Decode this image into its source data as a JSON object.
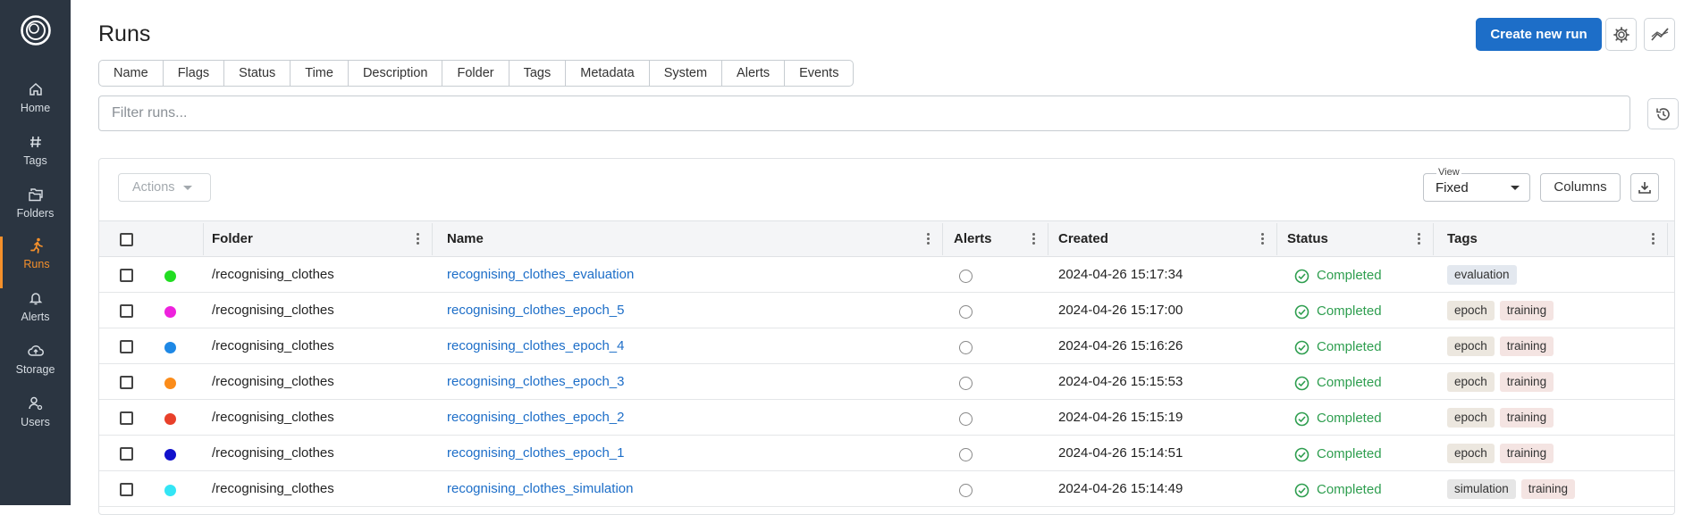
{
  "nav": [
    {
      "label": "Home",
      "icon": "home-icon"
    },
    {
      "label": "Tags",
      "icon": "hash-icon"
    },
    {
      "label": "Folders",
      "icon": "folders-icon"
    },
    {
      "label": "Runs",
      "icon": "running-icon",
      "active": true
    },
    {
      "label": "Alerts",
      "icon": "bell-icon"
    },
    {
      "label": "Storage",
      "icon": "cloud-upload-icon"
    },
    {
      "label": "Users",
      "icon": "users-icon"
    }
  ],
  "header": {
    "title": "Runs",
    "create_label": "Create new run"
  },
  "column_tabs": [
    "Name",
    "Flags",
    "Status",
    "Time",
    "Description",
    "Folder",
    "Tags",
    "Metadata",
    "System",
    "Alerts",
    "Events"
  ],
  "filter": {
    "placeholder": "Filter runs..."
  },
  "toolbar": {
    "actions_label": "Actions",
    "view_legend": "View",
    "view_value": "Fixed",
    "columns_label": "Columns"
  },
  "table": {
    "headers": {
      "folder": "Folder",
      "name": "Name",
      "alerts": "Alerts",
      "created": "Created",
      "status": "Status",
      "tags": "Tags"
    },
    "rows": [
      {
        "color": "#22dd22",
        "folder": "/recognising_clothes",
        "name": "recognising_clothes_evaluation",
        "created": "2024-04-26 15:17:34",
        "status": "Completed",
        "tags": [
          "evaluation"
        ]
      },
      {
        "color": "#ee22dd",
        "folder": "/recognising_clothes",
        "name": "recognising_clothes_epoch_5",
        "created": "2024-04-26 15:17:00",
        "status": "Completed",
        "tags": [
          "epoch",
          "training"
        ]
      },
      {
        "color": "#1e88e5",
        "folder": "/recognising_clothes",
        "name": "recognising_clothes_epoch_4",
        "created": "2024-04-26 15:16:26",
        "status": "Completed",
        "tags": [
          "epoch",
          "training"
        ]
      },
      {
        "color": "#fb8c1a",
        "folder": "/recognising_clothes",
        "name": "recognising_clothes_epoch_3",
        "created": "2024-04-26 15:15:53",
        "status": "Completed",
        "tags": [
          "epoch",
          "training"
        ]
      },
      {
        "color": "#e8402a",
        "folder": "/recognising_clothes",
        "name": "recognising_clothes_epoch_2",
        "created": "2024-04-26 15:15:19",
        "status": "Completed",
        "tags": [
          "epoch",
          "training"
        ]
      },
      {
        "color": "#1111cc",
        "folder": "/recognising_clothes",
        "name": "recognising_clothes_epoch_1",
        "created": "2024-04-26 15:14:51",
        "status": "Completed",
        "tags": [
          "epoch",
          "training"
        ]
      },
      {
        "color": "#33e5f5",
        "folder": "/recognising_clothes",
        "name": "recognising_clothes_simulation",
        "created": "2024-04-26 15:14:49",
        "status": "Completed",
        "tags": [
          "simulation",
          "training"
        ]
      }
    ]
  }
}
